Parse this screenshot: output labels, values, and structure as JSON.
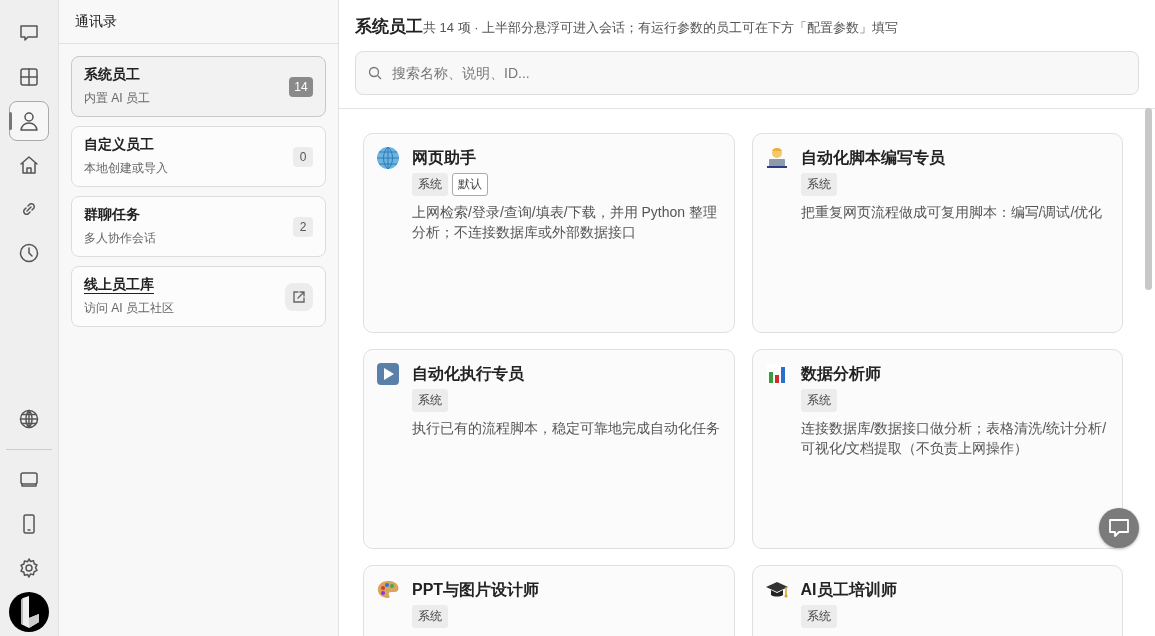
{
  "rail": {
    "items": [
      {
        "selected": false
      },
      {
        "selected": false
      },
      {
        "selected": true
      },
      {
        "selected": false
      },
      {
        "selected": false
      },
      {
        "selected": false
      }
    ]
  },
  "contacts": {
    "title": "通讯录",
    "items": [
      {
        "kind": "count",
        "title": "系统员工",
        "subtitle": "内置 AI 员工",
        "count": "14",
        "selected": true
      },
      {
        "kind": "count",
        "title": "自定义员工",
        "subtitle": "本地创建或导入",
        "count": "0",
        "selected": false
      },
      {
        "kind": "count",
        "title": "群聊任务",
        "subtitle": "多人协作会话",
        "count": "2",
        "selected": false
      },
      {
        "kind": "link",
        "title": "线上员工库",
        "subtitle": "访问 AI 员工社区",
        "selected": false
      }
    ]
  },
  "main": {
    "title": "系统员工",
    "subtitle": "共 14 项 · 上半部分悬浮可进入会话；有运行参数的员工可在下方「配置参数」填写",
    "search": {
      "placeholder": "搜索名称、说明、ID..."
    },
    "cards": [
      {
        "name": "网页助手",
        "tags": [
          {
            "kind": "filled",
            "label": "系统"
          },
          {
            "kind": "outline",
            "label": "默认"
          }
        ],
        "description": "上网检索/登录/查询/填表/下载，并用 Python 整理分析；不连接数据库或外部数据接口"
      },
      {
        "name": "自动化脚本编写专员",
        "tags": [
          {
            "kind": "filled",
            "label": "系统"
          }
        ],
        "description": "把重复网页流程做成可复用脚本：编写/调试/优化"
      },
      {
        "name": "自动化执行专员",
        "tags": [
          {
            "kind": "filled",
            "label": "系统"
          }
        ],
        "description": "执行已有的流程脚本，稳定可靠地完成自动化任务"
      },
      {
        "name": "数据分析师",
        "tags": [
          {
            "kind": "filled",
            "label": "系统"
          }
        ],
        "description": "连接数据库/数据接口做分析；表格清洗/统计分析/可视化/文档提取（不负责上网操作）"
      },
      {
        "name": "PPT与图片设计师",
        "tags": [
          {
            "kind": "filled",
            "label": "系统"
          }
        ]
      },
      {
        "name": "AI员工培训师",
        "tags": [
          {
            "kind": "filled",
            "label": "系统"
          }
        ]
      }
    ]
  }
}
